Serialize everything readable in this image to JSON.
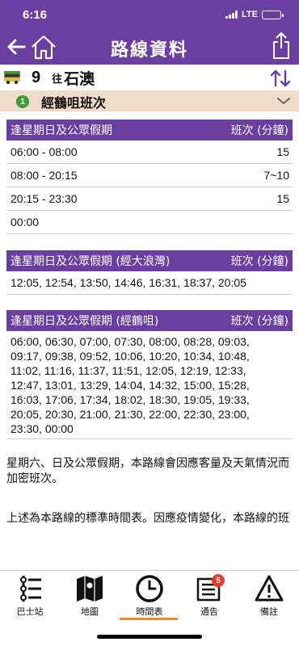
{
  "status_bar": {
    "time": "6:16",
    "network": "LTE"
  },
  "header": {
    "title": "路線資料"
  },
  "route": {
    "number": "9",
    "direction_prefix": "往",
    "destination": "石澳"
  },
  "variant": {
    "badge": "1",
    "label": "經鶴咀班次"
  },
  "schedule": {
    "table1": {
      "heading": "逢星期日及公眾假期",
      "freq_heading": "班次 (分鐘)",
      "rows": [
        {
          "time": "06:00 - 08:00",
          "freq": "15"
        },
        {
          "time": "08:00 - 20:15",
          "freq": "7~10"
        },
        {
          "time": "20:15 - 23:30",
          "freq": "15"
        },
        {
          "time": "00:00",
          "freq": ""
        }
      ]
    },
    "table2": {
      "heading": "逢星期日及公眾假期 (經大浪灣)",
      "freq_heading": "班次 (分鐘)",
      "times": "12:05, 12:54, 13:50, 14:46, 16:31, 18:37, 20:05"
    },
    "table3": {
      "heading": "逢星期日及公眾假期 (經鶴咀)",
      "freq_heading": "班次 (分鐘)",
      "lines": [
        "06:00, 06:30, 07:00, 07:30, 08:00, 08:28, 09:03,",
        "09:17, 09:38, 09:52, 10:06, 10:20, 10:34, 10:48,",
        "11:02, 11:16, 11:37, 11:51, 12:05, 12:19, 12:33,",
        "12:47, 13:01, 13:29, 14:04, 14:32, 15:00, 15:28,",
        "16:03, 17:06, 17:34, 18:02, 18:30, 19:05, 19:33,",
        "20:05, 20:30, 21:00, 21:30, 22:00, 22:30, 23:00,",
        "23:30, 00:00"
      ]
    }
  },
  "notes": {
    "note1": "星期六、日及公眾假期，本路線會因應客量及天氣情況而加密班次。",
    "note2": "上述為本路線的標準時間表。因應疫情變化，本路線的班"
  },
  "tabs": [
    {
      "label": "巴士站",
      "icon": "bus-stop-icon"
    },
    {
      "label": "地圖",
      "icon": "map-icon"
    },
    {
      "label": "時間表",
      "icon": "clock-icon"
    },
    {
      "label": "通告",
      "icon": "notice-icon",
      "badge": "5"
    },
    {
      "label": "備註",
      "icon": "warning-icon"
    }
  ],
  "colors": {
    "header": "#6a3fa0",
    "variant_bg": "#eedcc8",
    "badge_green": "#3a9d3a",
    "active_tab": "#e88a2e",
    "notice_badge": "#e53b2c"
  }
}
